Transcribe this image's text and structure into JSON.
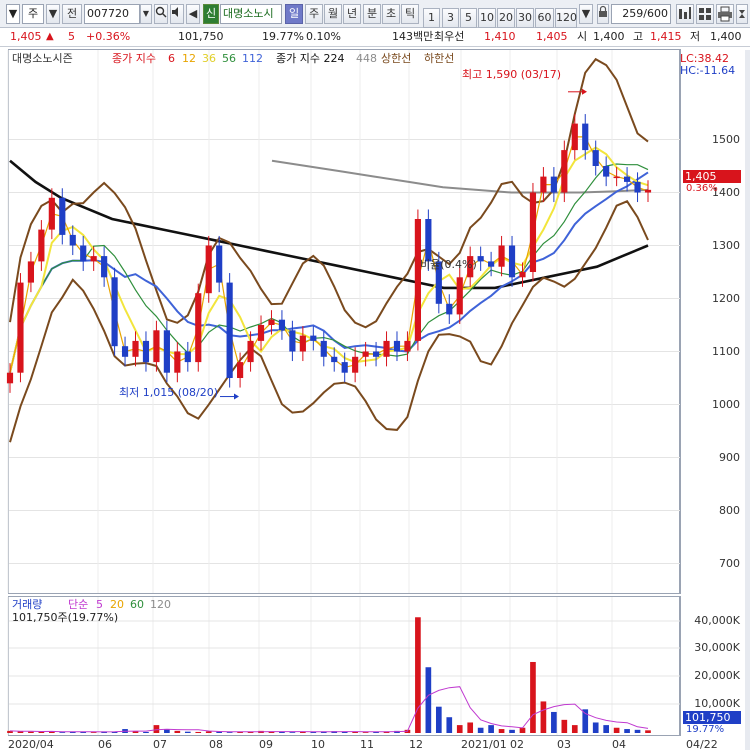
{
  "toolbar": {
    "market": "주",
    "prev_button": "전",
    "stock_code": "007720",
    "tag_new": "신",
    "stock_name": "대명소노시",
    "period_tabs": [
      "일",
      "주",
      "월",
      "년",
      "분",
      "초",
      "틱"
    ],
    "active_period": "일",
    "interval_buttons": [
      "1",
      "3",
      "5",
      "10",
      "20",
      "30",
      "60",
      "120"
    ],
    "count": "259",
    "count_total": "/600"
  },
  "quote": {
    "price": "1,405",
    "change": "5",
    "change_pct": "+0.36%",
    "volume": "101,750",
    "volume_ratio": "19.77%",
    "turnover": "0.10%",
    "amount": "143백만",
    "preferred_label": "최우선",
    "ask": "1,410",
    "bid": "1,405",
    "open_label": "시",
    "open": "1,400",
    "high_label": "고",
    "high": "1,415",
    "low_label": "저",
    "low": "1,400"
  },
  "price_panel": {
    "legend": {
      "name": "대명소노시즌",
      "ma_label": "종가 지수",
      "ma_periods": [
        "6",
        "12",
        "36",
        "56",
        "112"
      ],
      "ma_long_label": "종가 지수 224",
      "ma_long_2": "448",
      "upper_limit": "상한선",
      "lower_limit": "하한선"
    },
    "lc": "LC:38.42",
    "hc": "HC:-11.64",
    "current_price_tag": "1,405",
    "current_change_tag": "0.36%",
    "annotation_high": "최고 1,590 (03/17)",
    "annotation_low": "최저 1,015 (08/20)",
    "annotation_mid": "비율(0.4%)"
  },
  "volume_panel": {
    "legend": {
      "name": "거래량",
      "ma_label": "단순",
      "ma_periods": [
        "5",
        "20",
        "60",
        "120"
      ],
      "current": "101,750주(19.77%)"
    },
    "current_tag": "101,750",
    "current_ratio_tag": "19.77%"
  },
  "x_axis": {
    "ticks": [
      "2020/04",
      "06",
      "07",
      "08",
      "09",
      "10",
      "11",
      "12",
      "2021/01",
      "02",
      "03",
      "04"
    ],
    "end_label": "04/22"
  },
  "colors": {
    "up": "#d8141c",
    "down": "#1f3fc6",
    "ma6": "#d8141c",
    "ma12": "#e8a400",
    "ma36": "#f2e53c",
    "ma56": "#2f8f3c",
    "ma112": "#3f63d8",
    "ma224": "#111111",
    "ma448": "#8c8c8c",
    "envelope": "#7a4a1e"
  },
  "chart_data": [
    {
      "type": "line",
      "title": "대명소노시즌",
      "y_ticks": [
        700,
        800,
        900,
        1000,
        1100,
        1200,
        1300,
        1400,
        1500
      ],
      "ylim": [
        650,
        1650
      ],
      "x_ticks": [
        "2020/04",
        "06",
        "07",
        "08",
        "09",
        "10",
        "11",
        "12",
        "2021/01",
        "02",
        "03",
        "04"
      ],
      "series": [
        {
          "name": "종가",
          "values": [
            1060,
            1230,
            1270,
            1330,
            1390,
            1320,
            1300,
            1270,
            1280,
            1240,
            1110,
            1090,
            1120,
            1080,
            1140,
            1060,
            1100,
            1080,
            1210,
            1300,
            1230,
            1050,
            1080,
            1120,
            1150,
            1160,
            1140,
            1100,
            1130,
            1120,
            1090,
            1080,
            1060,
            1090,
            1100,
            1090,
            1120,
            1100,
            1120,
            1350,
            1270,
            1190,
            1170,
            1240,
            1280,
            1270,
            1260,
            1300,
            1240,
            1250,
            1400,
            1430,
            1400,
            1480,
            1530,
            1480,
            1450,
            1430,
            1430,
            1420,
            1400,
            1405
          ]
        },
        {
          "name": "224",
          "values": [
            1460,
            1420,
            1390,
            1370,
            1350,
            1340,
            1330,
            1320,
            1310,
            1300,
            1290,
            1280,
            1270,
            1260,
            1250,
            1240,
            1230,
            1220,
            1220,
            1220,
            1230,
            1240,
            1250,
            1260,
            1280,
            1300
          ]
        },
        {
          "name": "448",
          "values": [
            1460,
            1450,
            1440,
            1430,
            1420,
            1410,
            1405,
            1400,
            1400,
            1400,
            1402,
            1405
          ]
        }
      ],
      "annotations": [
        {
          "label": "최고 1,590 (03/17)",
          "value": 1590
        },
        {
          "label": "최저 1,015 (08/20)",
          "value": 1015
        }
      ]
    },
    {
      "type": "bar",
      "title": "거래량",
      "y_ticks": [
        "10,000K",
        "20,000K",
        "30,000K",
        "40,000K"
      ],
      "ylim": [
        0,
        46000
      ],
      "values": [
        800,
        600,
        500,
        400,
        700,
        300,
        500,
        400,
        300,
        600,
        500,
        1500,
        700,
        400,
        3000,
        1500,
        800,
        500,
        400,
        600,
        500,
        300,
        400,
        500,
        800,
        600,
        400,
        300,
        500,
        400,
        600,
        700,
        500,
        400,
        300,
        500,
        600,
        800,
        1200,
        44000,
        25000,
        10000,
        6000,
        3000,
        4000,
        2000,
        3000,
        1500,
        1200,
        2000,
        27000,
        12000,
        8000,
        5000,
        3000,
        9000,
        4000,
        3000,
        2000,
        1500,
        1200,
        1018
      ]
    }
  ]
}
